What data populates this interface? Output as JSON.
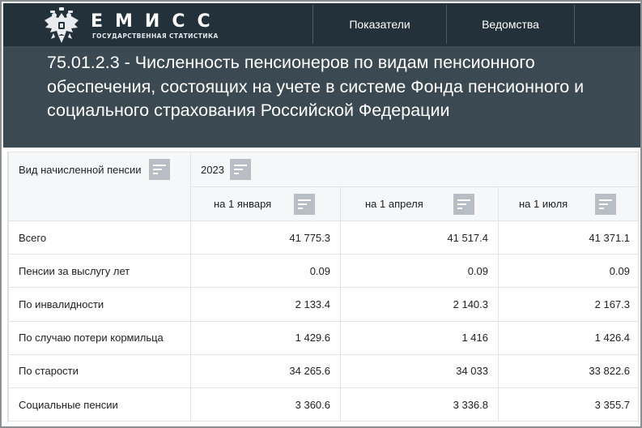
{
  "header": {
    "logo_title": "ЕМИСС",
    "logo_subtitle": "ГОСУДАРСТВЕННАЯ СТАТИСТИКА",
    "nav": [
      {
        "label": "Показатели"
      },
      {
        "label": "Ведомства"
      }
    ],
    "colors": {
      "topbar": "#23313a",
      "title_band": "#3b4a52"
    }
  },
  "page": {
    "title": "75.01.2.3 - Численность пенсионеров по видам пенсионного обеспечения, состоящих на учете в системе Фонда пенсионного и социального страхования Российской Федерации"
  },
  "table": {
    "row_header": "Вид начисленной пенсии",
    "year": "2023",
    "columns": [
      {
        "label": "на 1 января"
      },
      {
        "label": "на 1 апреля"
      },
      {
        "label": "на 1 июля"
      }
    ],
    "rows": [
      {
        "name": "Всего",
        "values": [
          "41 775.3",
          "41 517.4",
          "41 371.1"
        ]
      },
      {
        "name": "Пенсии за выслугу лет",
        "values": [
          "0.09",
          "0.09",
          "0.09"
        ]
      },
      {
        "name": "По инвалидности",
        "values": [
          "2 133.4",
          "2 140.3",
          "2 167.3"
        ]
      },
      {
        "name": "По случаю потери кормильца",
        "values": [
          "1 429.6",
          "1 416",
          "1 426.4"
        ]
      },
      {
        "name": "По старости",
        "values": [
          "34 265.6",
          "34 033",
          "33 822.6"
        ]
      },
      {
        "name": "Социальные пенсии",
        "values": [
          "3 360.6",
          "3 336.8",
          "3 355.7"
        ]
      }
    ]
  },
  "icons": {
    "emblem": "double-headed-eagle-icon",
    "sort": "sort-lines-icon"
  }
}
